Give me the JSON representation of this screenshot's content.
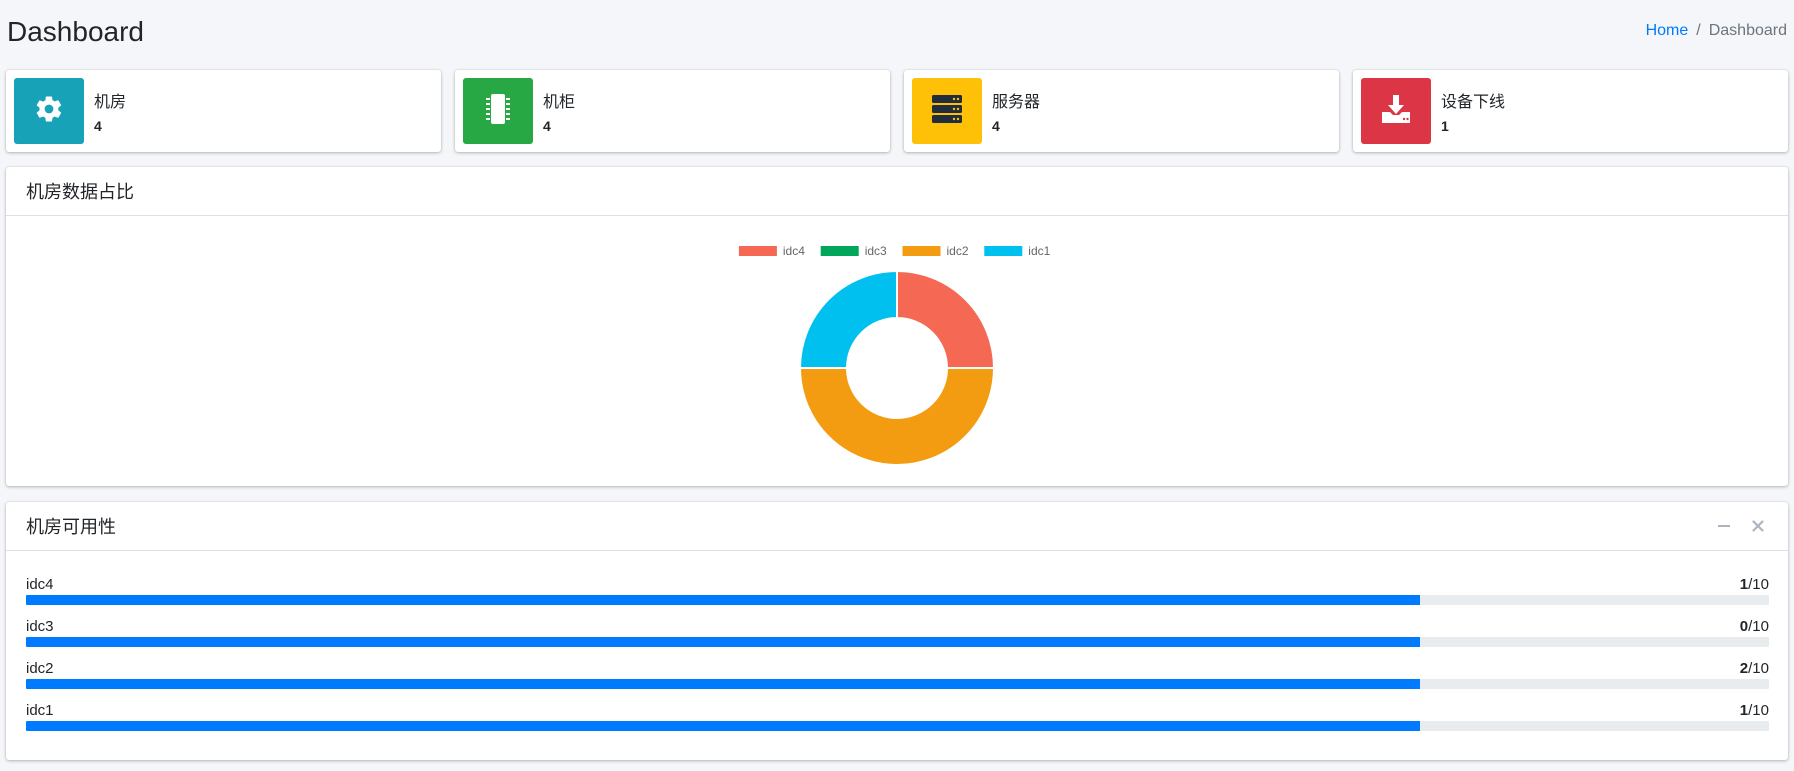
{
  "header": {
    "title": "Dashboard",
    "breadcrumb": {
      "home": "Home",
      "separator": "/",
      "current": "Dashboard"
    }
  },
  "info_boxes": [
    {
      "label": "机房",
      "value": "4",
      "icon": "gear-icon",
      "color": "#17a2b8"
    },
    {
      "label": "机柜",
      "value": "4",
      "icon": "chip-icon",
      "color": "#28a745"
    },
    {
      "label": "服务器",
      "value": "4",
      "icon": "server-icon",
      "color": "#ffc107"
    },
    {
      "label": "设备下线",
      "value": "1",
      "icon": "download-icon",
      "color": "#dc3545"
    }
  ],
  "chart_card": {
    "title": "机房数据占比"
  },
  "chart_data": {
    "type": "pie",
    "donut": true,
    "legend_position": "top",
    "slices": [
      {
        "label": "idc4",
        "value": 1,
        "color": "#f56954"
      },
      {
        "label": "idc3",
        "value": 0,
        "color": "#00a65a"
      },
      {
        "label": "idc2",
        "value": 2,
        "color": "#f39c12"
      },
      {
        "label": "idc1",
        "value": 1,
        "color": "#00c0ef"
      }
    ]
  },
  "availability_card": {
    "title": "机房可用性",
    "minimize_icon": "minus-icon",
    "close_icon": "close-icon",
    "items": [
      {
        "label": "idc4",
        "count": "1",
        "total": "/10",
        "fill": 0.8
      },
      {
        "label": "idc3",
        "count": "0",
        "total": "/10",
        "fill": 0.8
      },
      {
        "label": "idc2",
        "count": "2",
        "total": "/10",
        "fill": 0.8
      },
      {
        "label": "idc1",
        "count": "1",
        "total": "/10",
        "fill": 0.8
      }
    ]
  }
}
